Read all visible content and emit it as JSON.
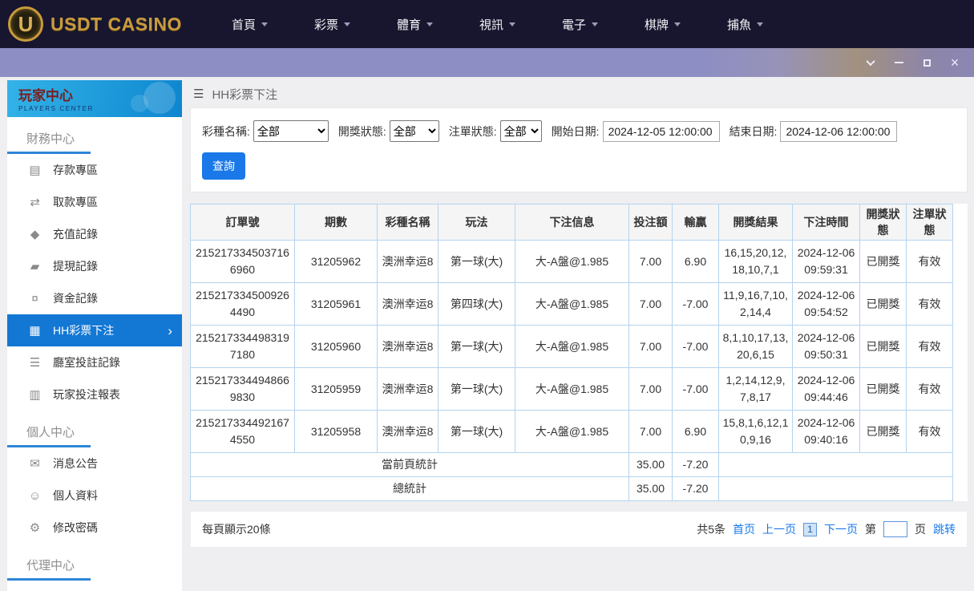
{
  "topnav": {
    "logo_badge": "U",
    "logo_text": "USDT CASINO",
    "items": [
      {
        "name": "home",
        "label": "首頁"
      },
      {
        "name": "lottery",
        "label": "彩票"
      },
      {
        "name": "sports",
        "label": "體育"
      },
      {
        "name": "live-video",
        "label": "視訊"
      },
      {
        "name": "slots",
        "label": "電子"
      },
      {
        "name": "card-games",
        "label": "棋牌"
      },
      {
        "name": "fishing",
        "label": "捕魚"
      }
    ]
  },
  "sidebar": {
    "title": "玩家中心",
    "subtitle": "PLAYERS CENTER",
    "sections": [
      {
        "name": "finance-center",
        "header": "財務中心",
        "items": [
          {
            "name": "deposit-zone",
            "label": "存款專區",
            "icon": "deposit-icon",
            "active": false
          },
          {
            "name": "withdraw-zone",
            "label": "取款專區",
            "icon": "withdraw-icon",
            "active": false
          },
          {
            "name": "recharge-records",
            "label": "充值記錄",
            "icon": "recharge-icon",
            "active": false
          },
          {
            "name": "withdrawal-records",
            "label": "提現記錄",
            "icon": "cashout-icon",
            "active": false
          },
          {
            "name": "fund-records",
            "label": "資金記錄",
            "icon": "funds-icon",
            "active": false
          },
          {
            "name": "hh-lottery-bets",
            "label": "HH彩票下注",
            "icon": "lottery-bet-icon",
            "active": true
          },
          {
            "name": "hall-bet-records",
            "label": "廳室投註記錄",
            "icon": "hall-record-icon",
            "active": false
          },
          {
            "name": "player-bet-report",
            "label": "玩家投注報表",
            "icon": "report-icon",
            "active": false
          }
        ]
      },
      {
        "name": "personal-center",
        "header": "個人中心",
        "items": [
          {
            "name": "announcements",
            "label": "消息公告",
            "icon": "bell-icon",
            "active": false
          },
          {
            "name": "profile",
            "label": "個人資料",
            "icon": "person-icon",
            "active": false
          },
          {
            "name": "change-password",
            "label": "修改密碼",
            "icon": "gear-icon",
            "active": false
          }
        ]
      },
      {
        "name": "agent-center",
        "header": "代理中心",
        "items": []
      }
    ]
  },
  "icons": {
    "hamburger-icon": "☰",
    "deposit-icon": "▤",
    "withdraw-icon": "⇄",
    "recharge-icon": "◆",
    "cashout-icon": "▰",
    "funds-icon": "¤",
    "lottery-bet-icon": "▦",
    "hall-record-icon": "☰",
    "report-icon": "▥",
    "bell-icon": "✉",
    "person-icon": "☺",
    "gear-icon": "⚙",
    "chevron-right-icon": "›"
  },
  "main": {
    "breadcrumb": "HH彩票下注",
    "filters": {
      "lottery_label": "彩種名稱:",
      "lottery_value": "全部",
      "draw_status_label": "開獎狀態:",
      "draw_status_value": "全部",
      "order_status_label": "注單狀態:",
      "order_status_value": "全部",
      "start_label": "開始日期:",
      "start_value": "2024-12-05 12:00:00",
      "end_label": "結束日期:",
      "end_value": "2024-12-06 12:00:00",
      "search_button": "查詢"
    },
    "table": {
      "headers": [
        "訂單號",
        "期數",
        "彩種名稱",
        "玩法",
        "下注信息",
        "投注額",
        "輸贏",
        "開獎結果",
        "下注時間",
        "開獎狀態",
        "注單狀態"
      ],
      "column_keys": [
        "order-no",
        "period",
        "lottery-name",
        "play-type",
        "bet-info",
        "bet-amount",
        "win-loss",
        "draw-result",
        "bet-time",
        "draw-status",
        "order-status"
      ],
      "rows": [
        [
          "2152173345037166960",
          "31205962",
          "澳洲幸运8",
          "第一球(大)",
          "大-A盤@1.985",
          "7.00",
          "6.90",
          "16,15,20,12,18,10,7,1",
          "2024-12-06 09:59:31",
          "已開獎",
          "有效"
        ],
        [
          "2152173345009264490",
          "31205961",
          "澳洲幸运8",
          "第四球(大)",
          "大-A盤@1.985",
          "7.00",
          "-7.00",
          "11,9,16,7,10,2,14,4",
          "2024-12-06 09:54:52",
          "已開獎",
          "有效"
        ],
        [
          "2152173344983197180",
          "31205960",
          "澳洲幸运8",
          "第一球(大)",
          "大-A盤@1.985",
          "7.00",
          "-7.00",
          "8,1,10,17,13,20,6,15",
          "2024-12-06 09:50:31",
          "已開獎",
          "有效"
        ],
        [
          "2152173344948669830",
          "31205959",
          "澳洲幸运8",
          "第一球(大)",
          "大-A盤@1.985",
          "7.00",
          "-7.00",
          "1,2,14,12,9,7,8,17",
          "2024-12-06 09:44:46",
          "已開獎",
          "有效"
        ],
        [
          "2152173344921674550",
          "31205958",
          "澳洲幸运8",
          "第一球(大)",
          "大-A盤@1.985",
          "7.00",
          "6.90",
          "15,8,1,6,12,10,9,16",
          "2024-12-06 09:40:16",
          "已開獎",
          "有效"
        ]
      ],
      "summary_rows": [
        {
          "label": "當前頁統計",
          "bet_total": "35.00",
          "winloss_total": "-7.20"
        },
        {
          "label": "總統計",
          "bet_total": "35.00",
          "winloss_total": "-7.20"
        }
      ]
    },
    "pager": {
      "per_page": "每頁顯示20條",
      "total": "共5条",
      "first": "首页",
      "prev": "上一页",
      "current_page": "1",
      "next": "下一页",
      "jump_prefix": "第",
      "jump_suffix": "页",
      "jump_button": "跳转"
    }
  },
  "colors": {
    "topbar": "#17162e",
    "gold": "#c89b3f",
    "titlebar": "#8d8ec2",
    "accent_blue": "#1a78e8",
    "active_item": "#1377d4",
    "table_border": "#b5d3ee"
  }
}
